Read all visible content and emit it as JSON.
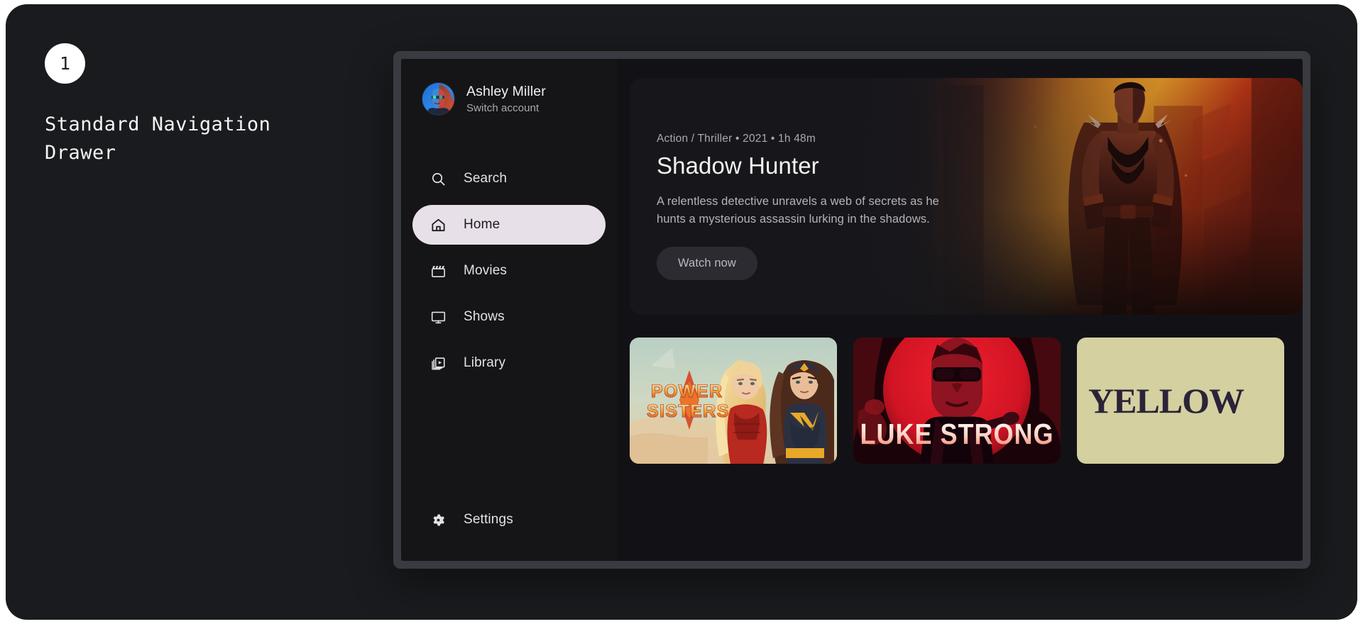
{
  "annotation": {
    "step_number": "1",
    "title": "Standard Navigation Drawer"
  },
  "colors": {
    "page_background": "#ffffff",
    "canvas_background": "#1a1b1e",
    "device_frame": "#3a3a41",
    "screen_background": "#121216",
    "drawer_background": "#151518",
    "active_item_background": "#e8e0e8",
    "active_item_text": "#1d1b20",
    "nav_text": "#e2e2e6",
    "accent_orange": "#f0873a",
    "accent_red": "#d8222c"
  },
  "drawer": {
    "account": {
      "name": "Ashley Miller",
      "switch_label": "Switch account",
      "avatar_alt": "user-avatar"
    },
    "items": [
      {
        "label": "Search",
        "icon": "search-icon",
        "active": false
      },
      {
        "label": "Home",
        "icon": "home-icon",
        "active": true
      },
      {
        "label": "Movies",
        "icon": "movie-icon",
        "active": false
      },
      {
        "label": "Shows",
        "icon": "tv-icon",
        "active": false
      },
      {
        "label": "Library",
        "icon": "library-icon",
        "active": false
      }
    ],
    "footer_item": {
      "label": "Settings",
      "icon": "gear-icon",
      "active": false
    }
  },
  "hero": {
    "meta": "Action / Thriller • 2021 • 1h 48m",
    "title": "Shadow Hunter",
    "description": "A relentless detective unravels a web of secrets as he hunts a mysterious assassin lurking in the shadows.",
    "cta_label": "Watch now",
    "artwork_alt": "superhero-hero-artwork"
  },
  "carousel": {
    "cards": [
      {
        "title": "POWER SISTERS",
        "art": "power-sisters-poster"
      },
      {
        "title": "LUKE STRONG",
        "art": "luke-strong-poster"
      },
      {
        "title": "YELLOW",
        "art": "yellow-poster"
      }
    ]
  }
}
